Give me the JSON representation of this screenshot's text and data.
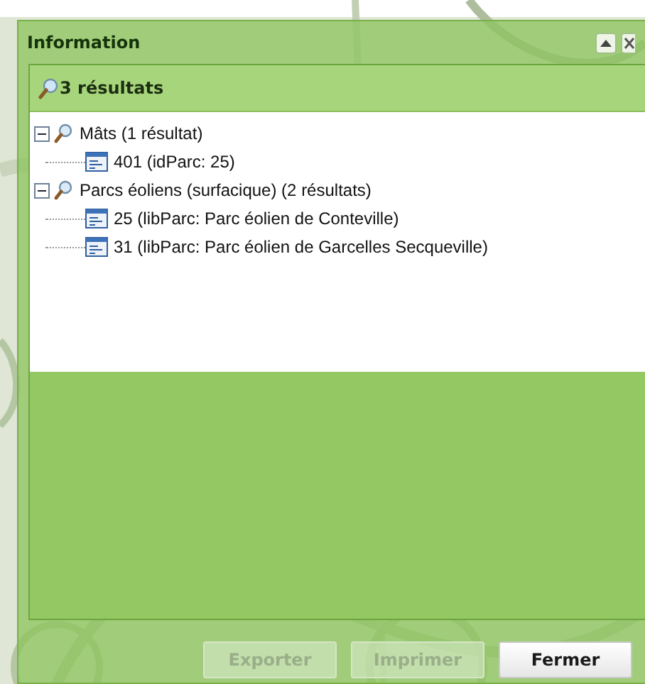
{
  "window": {
    "title": "Information"
  },
  "panel": {
    "title": "3 résultats"
  },
  "tree": [
    {
      "label": "Mâts (1 résultat)",
      "expanded": true,
      "children": [
        {
          "label": "401 (idParc: 25)"
        }
      ]
    },
    {
      "label": "Parcs éoliens (surfacique) (2 résultats)",
      "expanded": true,
      "children": [
        {
          "label": "25 (libParc: Parc éolien de Conteville)"
        },
        {
          "label": "31 (libParc: Parc éolien de Garcelles Secqueville)"
        }
      ]
    }
  ],
  "buttons": [
    {
      "label": "Exporter",
      "disabled": true
    },
    {
      "label": "Imprimer",
      "disabled": true
    },
    {
      "label": "Fermer",
      "disabled": false
    }
  ]
}
